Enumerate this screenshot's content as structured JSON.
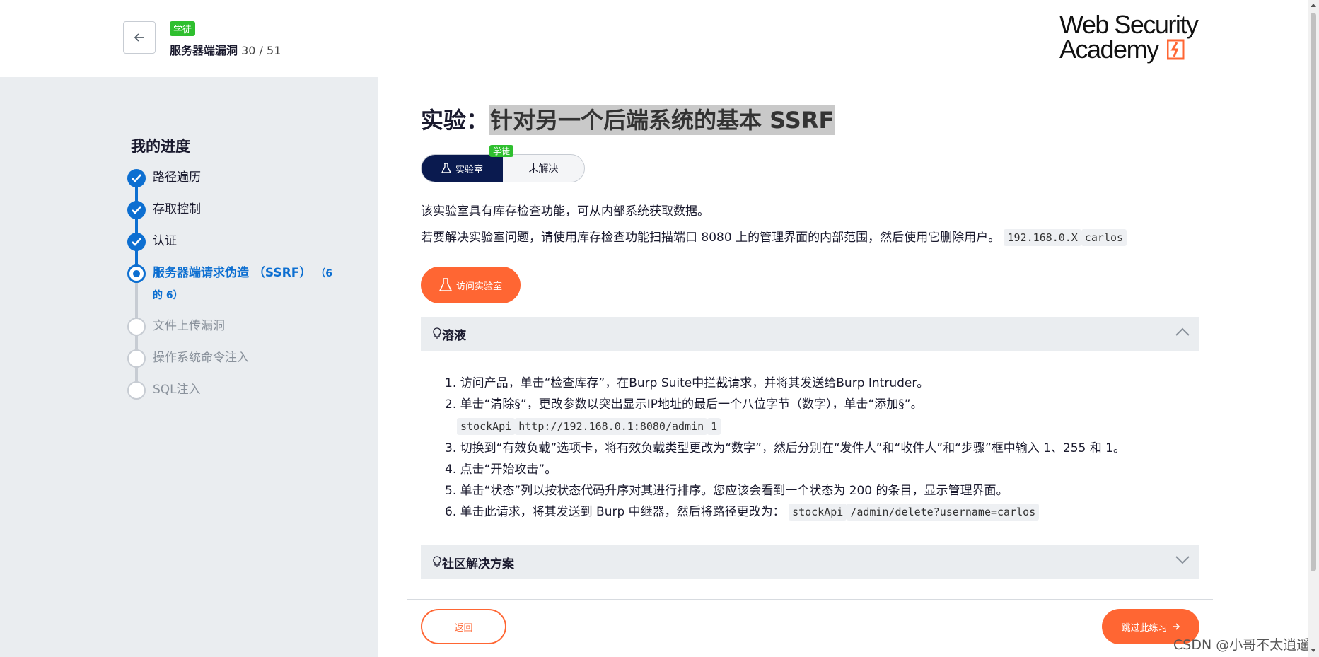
{
  "header": {
    "level_badge": "学徒",
    "topic_name": "服务器端漏洞",
    "topic_progress": "30 / 51",
    "logo_line1": "Web Security",
    "logo_line2": "Academy"
  },
  "sidebar": {
    "heading": "我的进度",
    "items": [
      {
        "label": "路径遍历",
        "state": "done"
      },
      {
        "label": "存取控制",
        "state": "done"
      },
      {
        "label": "认证",
        "state": "done"
      },
      {
        "label": "服务器端请求伪造 （SSRF）",
        "count": "（6 的 6）",
        "state": "current"
      },
      {
        "label": "文件上传漏洞",
        "state": "todo"
      },
      {
        "label": "操作系统命令注入",
        "state": "todo"
      },
      {
        "label": "SQL注入",
        "state": "todo"
      }
    ]
  },
  "lab": {
    "title_prefix": "实验：",
    "title_highlight": "针对另一个后端系统的基本 SSRF",
    "pill_badge": "学徒",
    "pill_left": "实验室",
    "pill_right": "未解决",
    "desc1": "该实验室具有库存检查功能，可从内部系统获取数据。",
    "desc2": "若要解决实验室问题，请使用库存检查功能扫描端口 8080 上的管理界面的内部范围，然后使用它删除用户。",
    "desc2_code1": "192.168.0.X",
    "desc2_code2": "carlos",
    "access_button": "访问实验室"
  },
  "solution": {
    "heading": "溶液",
    "steps": [
      "1. 访问产品，单击“检查库存”，在Burp Suite中拦截请求，并将其发送给Burp Intruder。",
      "2. 单击“清除§”，更改参数以突出显示IP地址的最后一个八位字节（数字），单击“添加§”。",
      "3. 切换到“有效负载”选项卡，将有效负载类型更改为“数字”，然后分别在“发件人”和“收件人”和“步骤”框中输入 1、255 和 1。",
      "4. 点击“开始攻击”。",
      "5. 单击“状态”列以按状态代码升序对其进行排序。您应该会看到一个状态为 200 的条目，显示管理界面。",
      "6. 单击此请求，将其发送到 Burp 中继器，然后将路径更改为："
    ],
    "step2_code1": "stockApi",
    "step2_code2": "http://192.168.0.1:8080/admin",
    "step2_code3": "1",
    "step6_code1": "stockApi",
    "step6_code2": "/admin/delete?username=carlos"
  },
  "community": {
    "heading": "社区解决方案"
  },
  "footer": {
    "return_button": "返回",
    "skip_button": "跳过此练习",
    "watermark": "CSDN @小哥不太逍遥"
  }
}
